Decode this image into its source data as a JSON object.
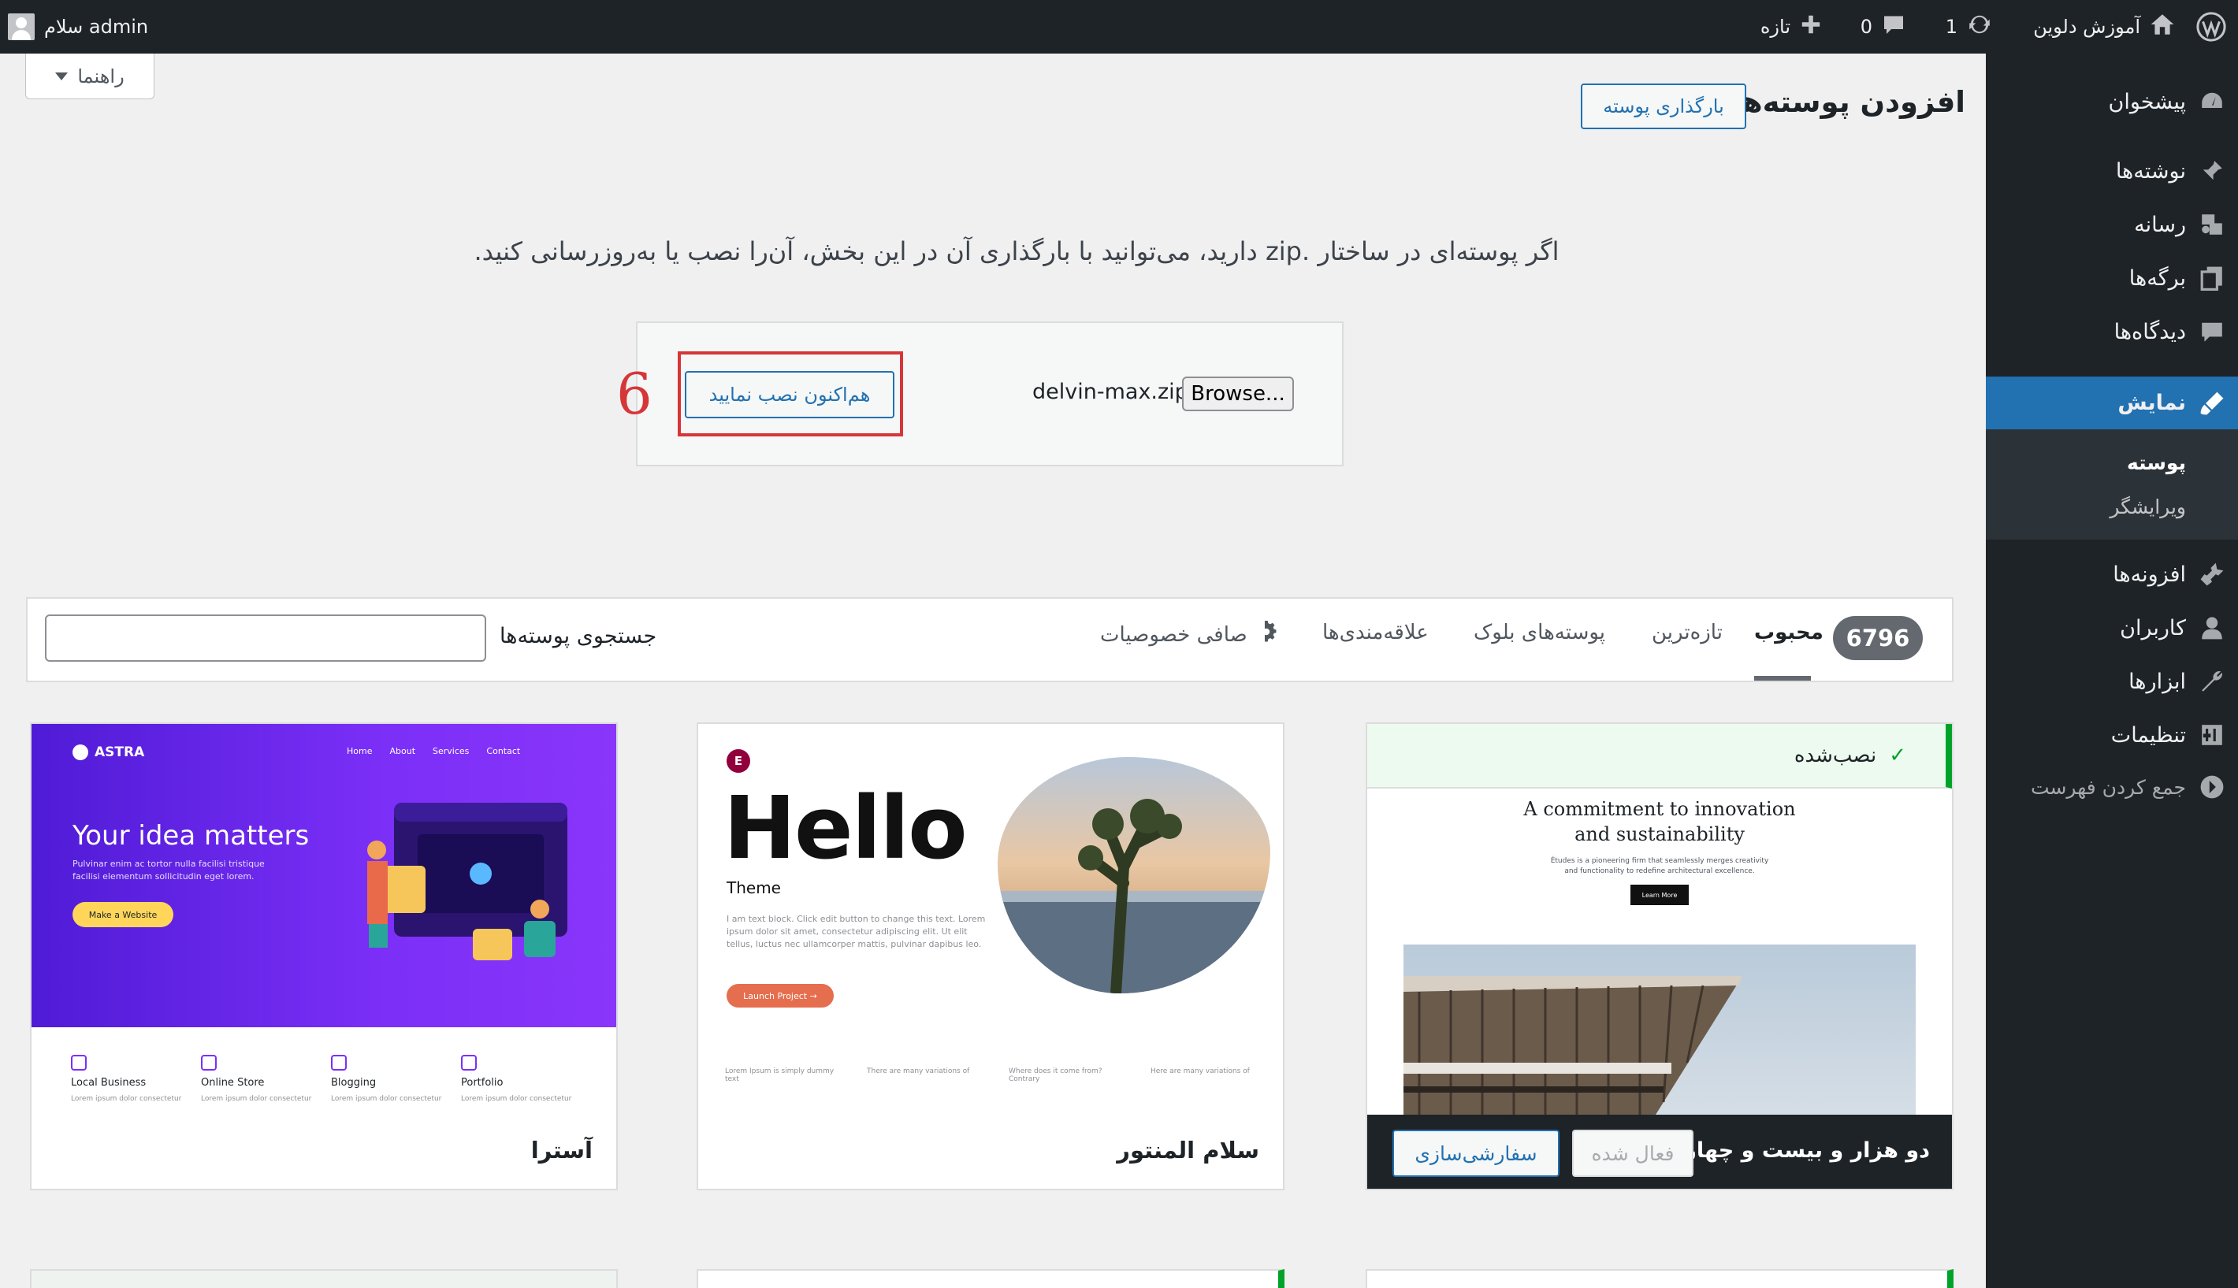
{
  "adminbar": {
    "site_name": "آموزش دلوین",
    "updates_count": "1",
    "comments_count": "0",
    "new_label": "تازه",
    "greeting": "سلام admin"
  },
  "sidebar": {
    "items": [
      {
        "label": "پیشخوان",
        "icon": "dashboard-icon"
      },
      {
        "label": "نوشته‌ها",
        "icon": "pin-icon"
      },
      {
        "label": "رسانه",
        "icon": "media-icon"
      },
      {
        "label": "برگه‌ها",
        "icon": "pages-icon"
      },
      {
        "label": "دیدگاه‌ها",
        "icon": "comments-icon"
      },
      {
        "label": "نمایش",
        "icon": "appearance-icon"
      },
      {
        "label": "افزونه‌ها",
        "icon": "plugins-icon"
      },
      {
        "label": "کاربران",
        "icon": "users-icon"
      },
      {
        "label": "ابزارها",
        "icon": "tools-icon"
      },
      {
        "label": "تنظیمات",
        "icon": "settings-icon"
      }
    ],
    "submenu": [
      {
        "label": "پوسته"
      },
      {
        "label": "ویرایشگر"
      }
    ],
    "collapse_label": "جمع کردن فهرست"
  },
  "help_tab": "راهنما",
  "page": {
    "title": "افزودن پوسته‌ها",
    "upload_button": "بارگذاری پوسته",
    "description": "اگر پوسته‌ای در ساختار .zip دارید، می‌توانید با بارگذاری آن در این بخش، آن‌را نصب یا به‌روزرسانی کنید."
  },
  "upload": {
    "browse_label": "Browse...",
    "file_name": "delvin-max.zip",
    "install_button": "هم‌اکنون نصب نمایید",
    "step_number": "6"
  },
  "filter": {
    "count": "6796",
    "tabs": [
      "محبوب",
      "تازه‌ترین",
      "پوسته‌های بلوک",
      "علاقه‌مندی‌ها"
    ],
    "feature_filter": "صافی خصوصیات",
    "search_label": "جستجوی پوسته‌ها",
    "search_value": ""
  },
  "themes": {
    "astra": {
      "name": "آسترا",
      "preview": {
        "logo": "ASTRA",
        "nav": [
          "Home",
          "About",
          "Services",
          "Contact"
        ],
        "headline": "Your idea matters",
        "sub": "Pulvinar enim ac tortor nulla facilisi tristique facilisi elementum sollicitudin eget lorem.",
        "button": "Make a Website",
        "features": [
          {
            "label": "Local Business",
            "note": "Lorem ipsum dolor consectetur"
          },
          {
            "label": "Online Store",
            "note": "Lorem ipsum dolor consectetur"
          },
          {
            "label": "Blogging",
            "note": "Lorem ipsum dolor consectetur"
          },
          {
            "label": "Portfolio",
            "note": "Lorem ipsum dolor consectetur"
          }
        ]
      }
    },
    "hello": {
      "name": "سلام المنتور",
      "preview": {
        "badge": "E",
        "title": "Hello",
        "subtitle": "Theme",
        "text": "I am text block. Click edit button to change this text. Lorem ipsum dolor sit amet, consectetur adipiscing elit. Ut elit tellus, luctus nec ullamcorper mattis, pulvinar dapibus leo.",
        "button": "Launch Project →",
        "features": [
          "Lorem Ipsum is simply dummy text",
          "There are many variations of",
          "Where does it come from? Contrary",
          "Here are many variations of"
        ]
      }
    },
    "active": {
      "name": "دو هزار و بیست و چهار",
      "installed_label": "نصب‌شده",
      "activated_label": "فعال شده",
      "customize_label": "سفارشی‌سازی",
      "preview": {
        "title_line1": "A commitment to innovation",
        "title_line2": "and sustainability",
        "sub_line1": "Études is a pioneering firm that seamlessly merges creativity",
        "sub_line2": "and functionality to redefine architectural excellence.",
        "button": "Learn More"
      }
    }
  },
  "colors": {
    "admin_bar": "#1d2327",
    "accent": "#2271b1",
    "highlight": "#d63638",
    "installed": "#00a32a"
  }
}
